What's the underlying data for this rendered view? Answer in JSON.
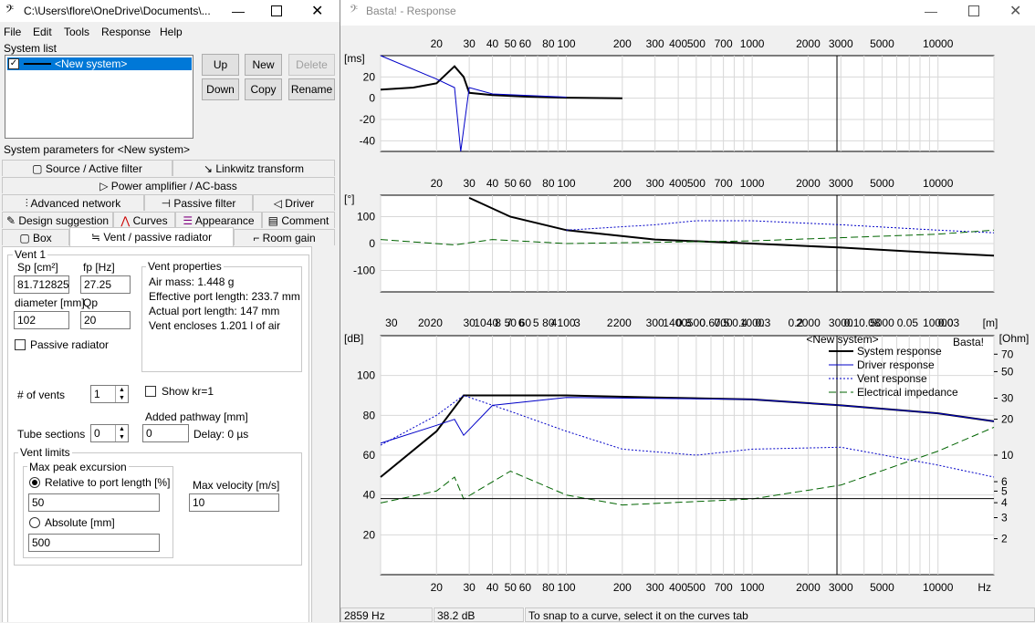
{
  "left_window": {
    "title": "C:\\Users\\flore\\OneDrive\\Documents\\...",
    "menu": [
      "File",
      "Edit",
      "Tools",
      "Response",
      "Help"
    ],
    "system_list_label": "System list",
    "system_item": "<New system>",
    "buttons": {
      "up": "Up",
      "new": "New",
      "delete": "Delete",
      "down": "Down",
      "copy": "Copy",
      "rename": "Rename"
    },
    "params_label": "System parameters for <New system>",
    "tabs": {
      "source": "Source / Active filter",
      "linkwitz": "Linkwitz transform",
      "power": "Power amplifier / AC-bass",
      "network": "Advanced network",
      "passive": "Passive filter",
      "driver": "Driver",
      "design": "Design suggestion",
      "curves": "Curves",
      "appearance": "Appearance",
      "comment": "Comment",
      "box": "Box",
      "vent": "Vent / passive radiator",
      "room": "Room gain"
    },
    "vent": {
      "group_label": "Vent 1",
      "sp_label": "Sp [cm²]",
      "sp_value": "81.712825",
      "fp_label": "fp [Hz]",
      "fp_value": "27.25",
      "diameter_label": "diameter [mm]",
      "diameter_value": "102",
      "qp_label": "Qp",
      "qp_value": "20",
      "props_label": "Vent properties",
      "air_mass": "Air mass: 1.448 g",
      "effective_length": "Effective port length: 233.7 mm",
      "actual_length": "Actual port length: 147 mm",
      "encloses": "Vent encloses 1.201 l of air",
      "passive_radiator": "Passive radiator",
      "num_vents_label": "# of vents",
      "num_vents_value": "1",
      "show_kr": "Show kr=1",
      "added_pathway_label": "Added pathway [mm]",
      "added_pathway_value": "0",
      "delay": "Delay: 0 µs",
      "tube_sections_label": "Tube sections",
      "tube_sections_value": "0",
      "limits_label": "Vent limits",
      "excursion_label": "Max peak excursion",
      "relative_label": "Relative to port length [%]",
      "relative_value": "50",
      "absolute_label": "Absolute [mm]",
      "absolute_value": "500",
      "max_velocity_label": "Max velocity [m/s]",
      "max_velocity_value": "10"
    }
  },
  "right_window": {
    "title": "Basta! - Response",
    "watermark": "Basta!",
    "freq_ticks": [
      "20",
      "30",
      "40",
      "50",
      "60",
      "80",
      "100",
      "200",
      "300",
      "400",
      "500",
      "700",
      "1000",
      "2000",
      "3000",
      "5000",
      "10000"
    ],
    "wavelength_ticks": [
      "30",
      "20",
      "10",
      "8",
      "7",
      "6",
      "5",
      "4",
      "3",
      "2",
      "1",
      "0.8",
      "0.6",
      "0.5",
      "0.4",
      "0.3",
      "0.2",
      "0.1",
      "0.08",
      "0.05",
      "0.03"
    ],
    "wavelength_unit": "[m]",
    "hz_unit": "Hz",
    "ohm_unit": "[Ohm]",
    "delay_unit": "[ms]",
    "phase_unit": "[°]",
    "db_unit": "[dB]",
    "legend_title": "<New system>",
    "legend": [
      "System response",
      "Driver response",
      "Vent response",
      "Electrical impedance"
    ],
    "status": {
      "freq": "2859 Hz",
      "level": "38.2 dB",
      "hint": "To snap to a curve, select it on the curves tab"
    },
    "colors": {
      "system": "#000000",
      "driver": "#0000c8",
      "vent": "#0000c8",
      "impedance": "#006400"
    }
  },
  "chart_data": [
    {
      "type": "line",
      "ylabel": "[ms]",
      "y_ticks": [
        20,
        0,
        -20,
        -40
      ],
      "x_scale": "log",
      "series": [
        {
          "name": "System response",
          "x": [
            10,
            15,
            20,
            25,
            28,
            30,
            40,
            60,
            100,
            200
          ],
          "y": [
            8,
            10,
            14,
            30,
            20,
            5,
            3,
            1.5,
            0.5,
            0
          ]
        },
        {
          "name": "Driver response",
          "x": [
            10,
            20,
            25,
            27,
            30,
            40,
            100
          ],
          "y": [
            40,
            18,
            10,
            -50,
            10,
            4,
            1
          ]
        }
      ]
    },
    {
      "type": "line",
      "ylabel": "[°]",
      "y_ticks": [
        100,
        0,
        -100
      ],
      "x_scale": "log",
      "series": [
        {
          "name": "System response",
          "x": [
            30,
            50,
            100,
            300,
            1000,
            3000,
            10000,
            20000
          ],
          "y": [
            170,
            100,
            50,
            15,
            0,
            -15,
            -35,
            -45
          ]
        },
        {
          "name": "Vent response",
          "x": [
            100,
            300,
            500,
            1000,
            3000,
            10000,
            20000
          ],
          "y": [
            50,
            70,
            85,
            85,
            70,
            50,
            40
          ]
        },
        {
          "name": "Electrical impedance",
          "x": [
            10,
            25,
            40,
            100,
            1000,
            10000,
            20000
          ],
          "y": [
            15,
            -5,
            15,
            0,
            10,
            35,
            50
          ]
        }
      ]
    },
    {
      "type": "line",
      "ylabel": "[dB]",
      "y_ticks": [
        100,
        80,
        60,
        40,
        20
      ],
      "x_scale": "log",
      "series": [
        {
          "name": "System response",
          "x": [
            10,
            20,
            28,
            40,
            100,
            300,
            1000,
            3000,
            10000,
            20000
          ],
          "y": [
            49,
            72,
            90,
            90,
            90,
            89,
            88,
            85,
            81,
            77
          ]
        },
        {
          "name": "Driver response",
          "x": [
            10,
            20,
            25,
            28,
            40,
            100,
            1000,
            3000,
            10000,
            20000
          ],
          "y": [
            66,
            75,
            78,
            70,
            85,
            89,
            88,
            85,
            81,
            77
          ]
        },
        {
          "name": "Vent response",
          "x": [
            10,
            20,
            28,
            50,
            100,
            200,
            500,
            1000,
            3000,
            10000,
            20000
          ],
          "y": [
            65,
            80,
            90,
            82,
            72,
            63,
            60,
            63,
            64,
            55,
            49
          ]
        },
        {
          "name": "Electrical impedance",
          "x": [
            10,
            20,
            25,
            28,
            50,
            100,
            200,
            1000,
            3000,
            10000,
            20000
          ],
          "y": [
            36,
            42,
            49,
            38,
            52,
            40,
            35,
            38,
            45,
            62,
            74
          ]
        }
      ]
    }
  ]
}
